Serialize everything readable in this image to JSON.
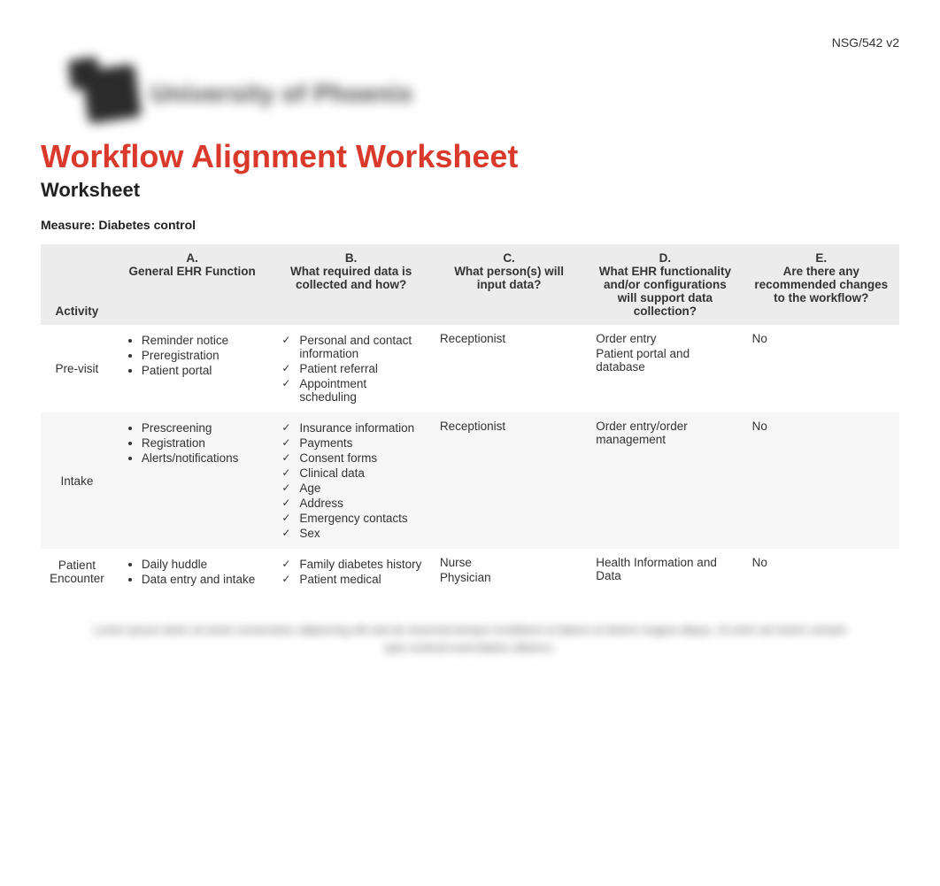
{
  "header": {
    "course_code": "NSG/542 v2",
    "logo_text": "University of Phoenix"
  },
  "title": "Workflow Alignment Worksheet",
  "subtitle": "Worksheet",
  "measure_label": "Measure: Diabetes control",
  "columns": {
    "activity": "Activity",
    "a": {
      "letter": "A.",
      "label": "General EHR Function"
    },
    "b": {
      "letter": "B.",
      "label": "What required data is collected and how?"
    },
    "c": {
      "letter": "C.",
      "label": "What person(s) will input data?"
    },
    "d": {
      "letter": "D.",
      "label": "What EHR functionality and/or configurations will support data collection?"
    },
    "e": {
      "letter": "E.",
      "label": "Are there any recommended changes to the workflow?"
    }
  },
  "rows": [
    {
      "activity": "Pre-visit",
      "a": [
        "Reminder notice",
        "Preregistration",
        "Patient portal"
      ],
      "b": [
        "Personal and contact information",
        "Patient referral",
        "Appointment scheduling"
      ],
      "c": [
        "Receptionist"
      ],
      "d": [
        "Order entry",
        "Patient portal and database"
      ],
      "e": "No"
    },
    {
      "activity": "Intake",
      "a": [
        "Prescreening",
        "Registration",
        "Alerts/notifications"
      ],
      "b": [
        "Insurance information",
        "Payments",
        "Consent forms",
        "Clinical data",
        "Age",
        "Address",
        "Emergency contacts",
        "Sex"
      ],
      "c": [
        "Receptionist"
      ],
      "d": [
        "Order entry/order management"
      ],
      "e": "No"
    },
    {
      "activity": "Patient Encounter",
      "a": [
        "Daily huddle",
        "Data entry and intake"
      ],
      "b": [
        "Family diabetes history",
        "Patient medical"
      ],
      "c": [
        "Nurse",
        "Physician"
      ],
      "d": [
        "Health Information and Data"
      ],
      "e": "No"
    }
  ],
  "footer_blur": "Lorem ipsum dolor sit amet consectetur adipiscing elit sed do eiusmod tempor incididunt ut labore et dolore magna aliqua. Ut enim ad minim veniam quis nostrud exercitation ullamco."
}
